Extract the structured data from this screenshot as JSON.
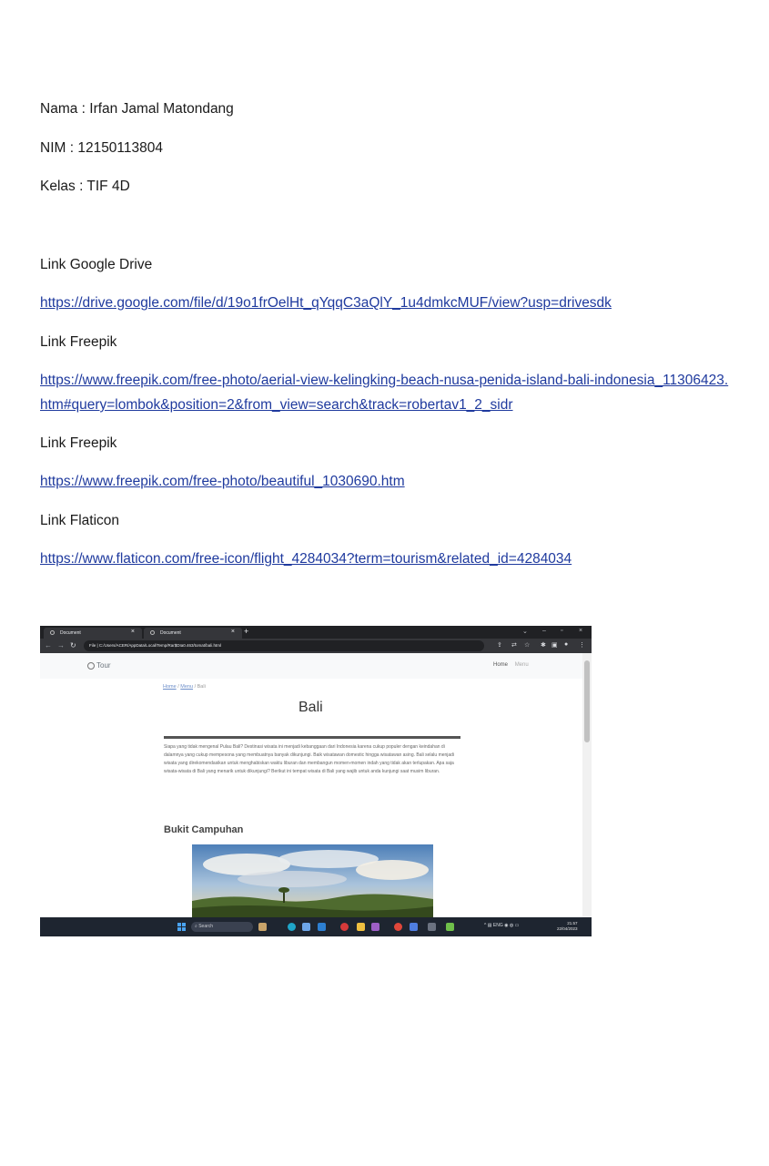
{
  "doc": {
    "nama": "Nama : Irfan Jamal Matondang",
    "nim": "NIM  : 12150113804",
    "kelas": "Kelas : TIF 4D",
    "label_gdrive": "Link Google Drive",
    "url_gdrive": "https://drive.google.com/file/d/19o1frOelHt_qYqqC3aQlY_1u4dmkcMUF/view?usp=drivesdk",
    "label_freepik_1": "Link Freepik",
    "url_freepik_1": "https://www.freepik.com/free-photo/aerial-view-kelingking-beach-nusa-penida-island-bali-indonesia_11306423.htm#query=lombok&position=2&from_view=search&track=robertav1_2_sidr",
    "label_freepik_2": "Link Freepik",
    "url_freepik_2": "https://www.freepik.com/free-photo/beautiful_1030690.htm",
    "label_flaticon": "Link Flaticon",
    "url_flaticon": "https://www.flaticon.com/free-icon/flight_4284034?term=tourism&related_id=4284034"
  },
  "screenshot": {
    "tabs": [
      {
        "label": "Document"
      },
      {
        "label": "Document"
      }
    ],
    "address": "File  |  C:/Users/ACER/AppData/Local/Temp/Rar$DIa0.463/tomat/bali.html",
    "site": {
      "brand": "Tour",
      "nav_home": "Home",
      "nav_menu": "Menu",
      "breadcrumb_home": "Home",
      "breadcrumb_menu": "Menu",
      "breadcrumb_current": "Bali",
      "heading": "Bali",
      "paragraph": "Siapa yang tidak mengenal Pulau Bali? Destinasi wisata ini menjadi kebanggaan dari Indonesia karena cukup populer dengan keindahan di dalamnya yang cukup mempesona yang membuatnya banyak dikunjungi. Baik wisatawan domestic hingga wisatawan asing. Bali selalu menjadi wisata yang direkomendasikan untuk menghabiskan waktu liburan dan membangun momen-momen indah yang tidak akan terlupakan. Apa saja wisata-wisata di Bali yang menarik untuk dikunjungi? Berikut ini tempat wisata di Bali yang wajib untuk anda kunjungi saat musim liburan.",
      "subheading": "Bukit Campuhan"
    },
    "taskbar": {
      "search": "Search",
      "lang": "ENG",
      "time": "21.57",
      "date": "22/04/2023"
    }
  }
}
